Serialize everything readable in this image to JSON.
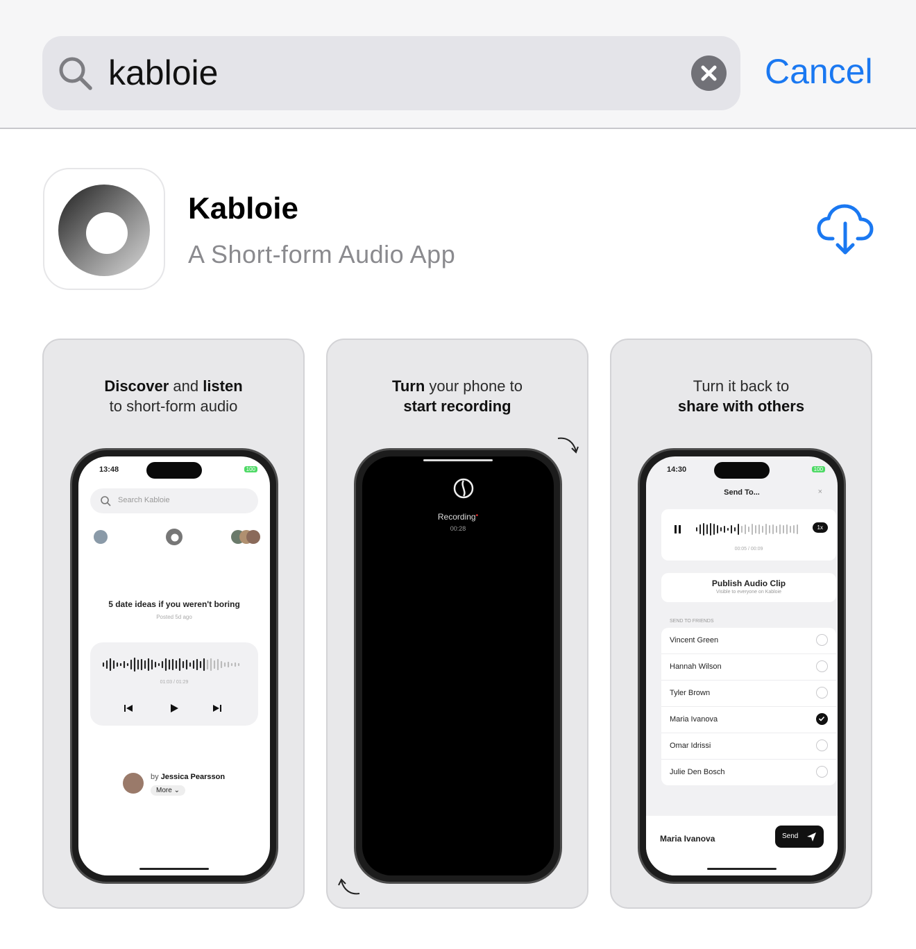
{
  "search": {
    "query": "kabloie",
    "cancel_label": "Cancel"
  },
  "app": {
    "name": "Kabloie",
    "subtitle": "A Short-form Audio App"
  },
  "screenshots": [
    {
      "caption_b1": "Discover",
      "caption_t1": " and ",
      "caption_b2": "listen",
      "caption_line2": "to short-form audio",
      "time": "13:48",
      "battery": "100",
      "search_placeholder": "Search Kabloie",
      "post_title": "5 date ideas if you weren't boring",
      "posted": "Posted 5d ago",
      "progress": "01:03  /  01:29",
      "by": "by",
      "author": "Jessica Pearsson",
      "more": "More"
    },
    {
      "caption_b1": "Turn",
      "caption_t1": " your phone to",
      "caption_line2b": "start recording",
      "recording_label": "Recording",
      "recording_time": "00:28"
    },
    {
      "caption_t1": "Turn it back to",
      "caption_line2b": "share with others",
      "time": "14:30",
      "battery": "100",
      "sheet_title": "Send To...",
      "speed": "1x",
      "progress": "00:05  /  00:09",
      "publish_title": "Publish Audio Clip",
      "publish_sub": "Visible to everyone on Kabloie",
      "section": "SEND TO FRIENDS",
      "friends": [
        "Vincent Green",
        "Hannah Wilson",
        "Tyler Brown",
        "Maria Ivanova",
        "Omar Idrissi",
        "Julie Den Bosch"
      ],
      "selected": "Maria Ivanova",
      "send": "Send"
    }
  ]
}
